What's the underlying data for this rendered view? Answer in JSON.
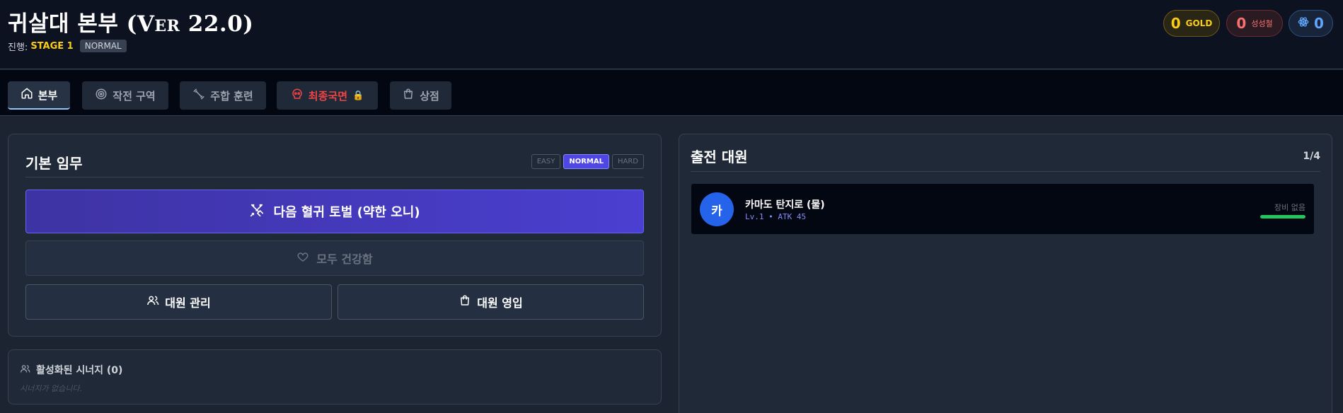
{
  "header": {
    "title_main": "귀살대 본부 (",
    "title_ver": "Ver 22.0",
    "title_close": ")",
    "progress_label": "진행:",
    "stage": "STAGE 1",
    "difficulty_badge": "NORMAL"
  },
  "currencies": {
    "gold": {
      "value": "0",
      "label": "GOLD"
    },
    "red": {
      "value": "0",
      "label": "성성철"
    },
    "blue": {
      "value": "0",
      "icon": "atom-icon"
    }
  },
  "tabs": [
    {
      "label": "본부",
      "icon": "home-icon",
      "active": true
    },
    {
      "label": "작전 구역",
      "icon": "target-icon"
    },
    {
      "label": "주합 훈련",
      "icon": "dumbbell-icon"
    },
    {
      "label": "최종국면",
      "icon": "skull-icon",
      "locked": true,
      "lock_glyph": "🔒"
    },
    {
      "label": "상점",
      "icon": "bag-icon"
    }
  ],
  "mission": {
    "title": "기본 임무",
    "difficulties": [
      "EASY",
      "NORMAL",
      "HARD"
    ],
    "selected_difficulty": "NORMAL",
    "primary_button": "다음 혈귀 토벌 (약한 오니)",
    "heal_button": "모두 건강함",
    "manage_button": "대원 관리",
    "recruit_button": "대원 영입"
  },
  "synergy": {
    "title": "활성화된 시너지 (0)",
    "empty_text": "시너지가 없습니다."
  },
  "squad": {
    "title": "출전 대원",
    "count": "1/4",
    "members": [
      {
        "avatar_letter": "카",
        "name": "카마도 탄지로 (물)",
        "stats": "Lv.1 • ATK 45",
        "equipment": "장비 없음",
        "hp_fraction": 1.0
      }
    ]
  },
  "colors": {
    "accent": "#4f46e5",
    "gold": "#facc15",
    "danger": "#ef4444",
    "hp": "#22c55e",
    "avatar": "#2563eb"
  }
}
